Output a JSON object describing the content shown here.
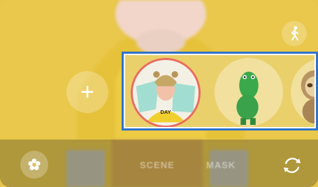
{
  "camera": {
    "modes": {
      "scene": "SCENE",
      "next": "MASK"
    },
    "stickers": [
      {
        "name": "avatar-sticker",
        "selected": true
      },
      {
        "name": "crocodile-sticker",
        "selected": false
      },
      {
        "name": "sloth-sticker",
        "selected": false
      }
    ],
    "colors": {
      "background": "#e9c84c",
      "selection_ring": "#ea6b62",
      "frame": "#2f73c6"
    }
  }
}
